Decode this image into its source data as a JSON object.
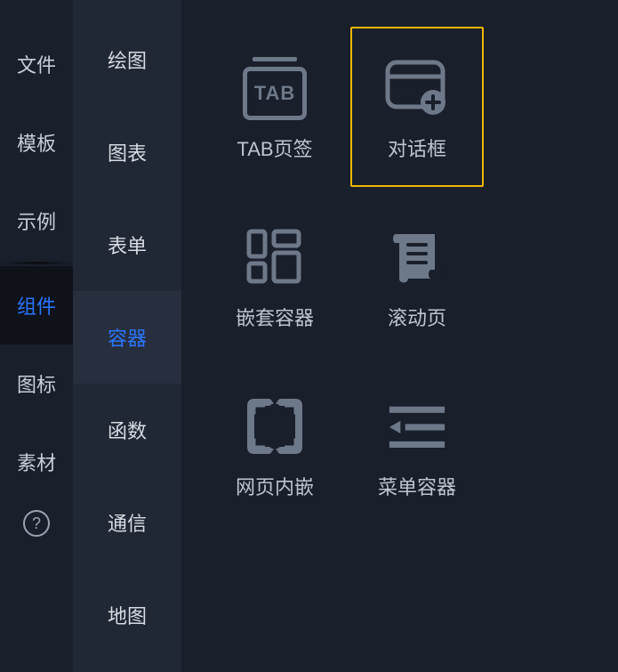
{
  "left_nav": {
    "items": [
      {
        "label": "文件"
      },
      {
        "label": "模板"
      },
      {
        "label": "示例"
      },
      {
        "label": "组件",
        "active": true
      },
      {
        "label": "图标"
      },
      {
        "label": "素材"
      }
    ],
    "help_label": "?"
  },
  "side_panel": {
    "items": [
      {
        "label": "绘图"
      },
      {
        "label": "图表"
      },
      {
        "label": "表单"
      },
      {
        "label": "容器",
        "active": true
      },
      {
        "label": "函数"
      },
      {
        "label": "通信"
      },
      {
        "label": "地图"
      }
    ]
  },
  "components": [
    {
      "id": "tab-page",
      "label": "TAB页签",
      "icon": "tab-icon",
      "tab_text": "TAB"
    },
    {
      "id": "dialog",
      "label": "对话框",
      "icon": "dialog-icon",
      "selected": true
    },
    {
      "id": "nested",
      "label": "嵌套容器",
      "icon": "nested-icon"
    },
    {
      "id": "scroll",
      "label": "滚动页",
      "icon": "scroll-icon"
    },
    {
      "id": "iframe",
      "label": "网页内嵌",
      "icon": "iframe-icon"
    },
    {
      "id": "menu",
      "label": "菜单容器",
      "icon": "menu-icon"
    }
  ]
}
